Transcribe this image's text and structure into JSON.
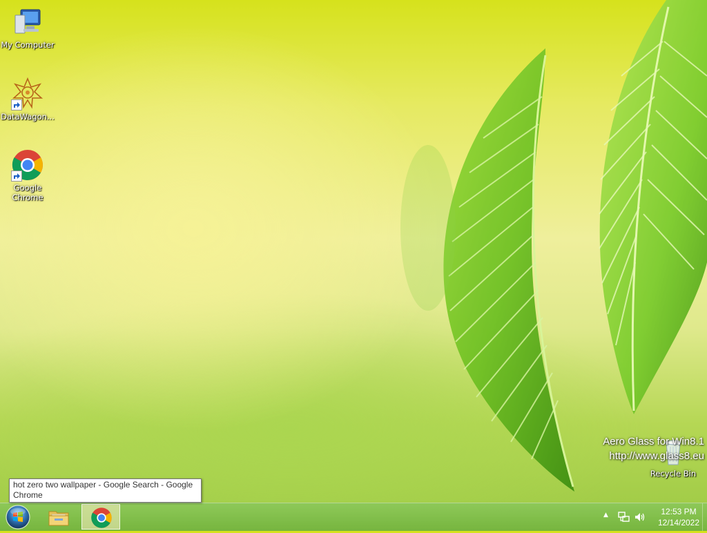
{
  "desktop": {
    "icons": [
      {
        "label": "My Computer",
        "icon": "computer-icon"
      },
      {
        "label": "DataWagon...",
        "icon": "datawagon-icon"
      },
      {
        "label": "Google Chrome",
        "icon": "chrome-icon"
      },
      {
        "label": "Recycle Bin",
        "icon": "recycle-bin-icon"
      }
    ],
    "watermark": {
      "line1": "Aero Glass for Win8.1",
      "line2": "http://www.glass8.eu"
    }
  },
  "tooltip": {
    "text": "hot zero two wallpaper - Google Search - Google Chrome"
  },
  "taskbar": {
    "start_icon": "windows-orb-icon",
    "pinned": [
      {
        "name": "File Explorer",
        "icon": "folder-icon"
      },
      {
        "name": "Google Chrome",
        "icon": "chrome-icon",
        "active": true
      }
    ],
    "tray": {
      "show_hidden_icon": "▲",
      "network_icon": "network-icon",
      "volume_icon": "speaker-icon",
      "time": "12:53 PM",
      "date": "12/14/2022"
    }
  },
  "colors": {
    "wallpaper_top": "#d6e21c",
    "wallpaper_mid": "#efef9c",
    "leaf": "#7dc62a",
    "taskbar": "#74b43e"
  }
}
